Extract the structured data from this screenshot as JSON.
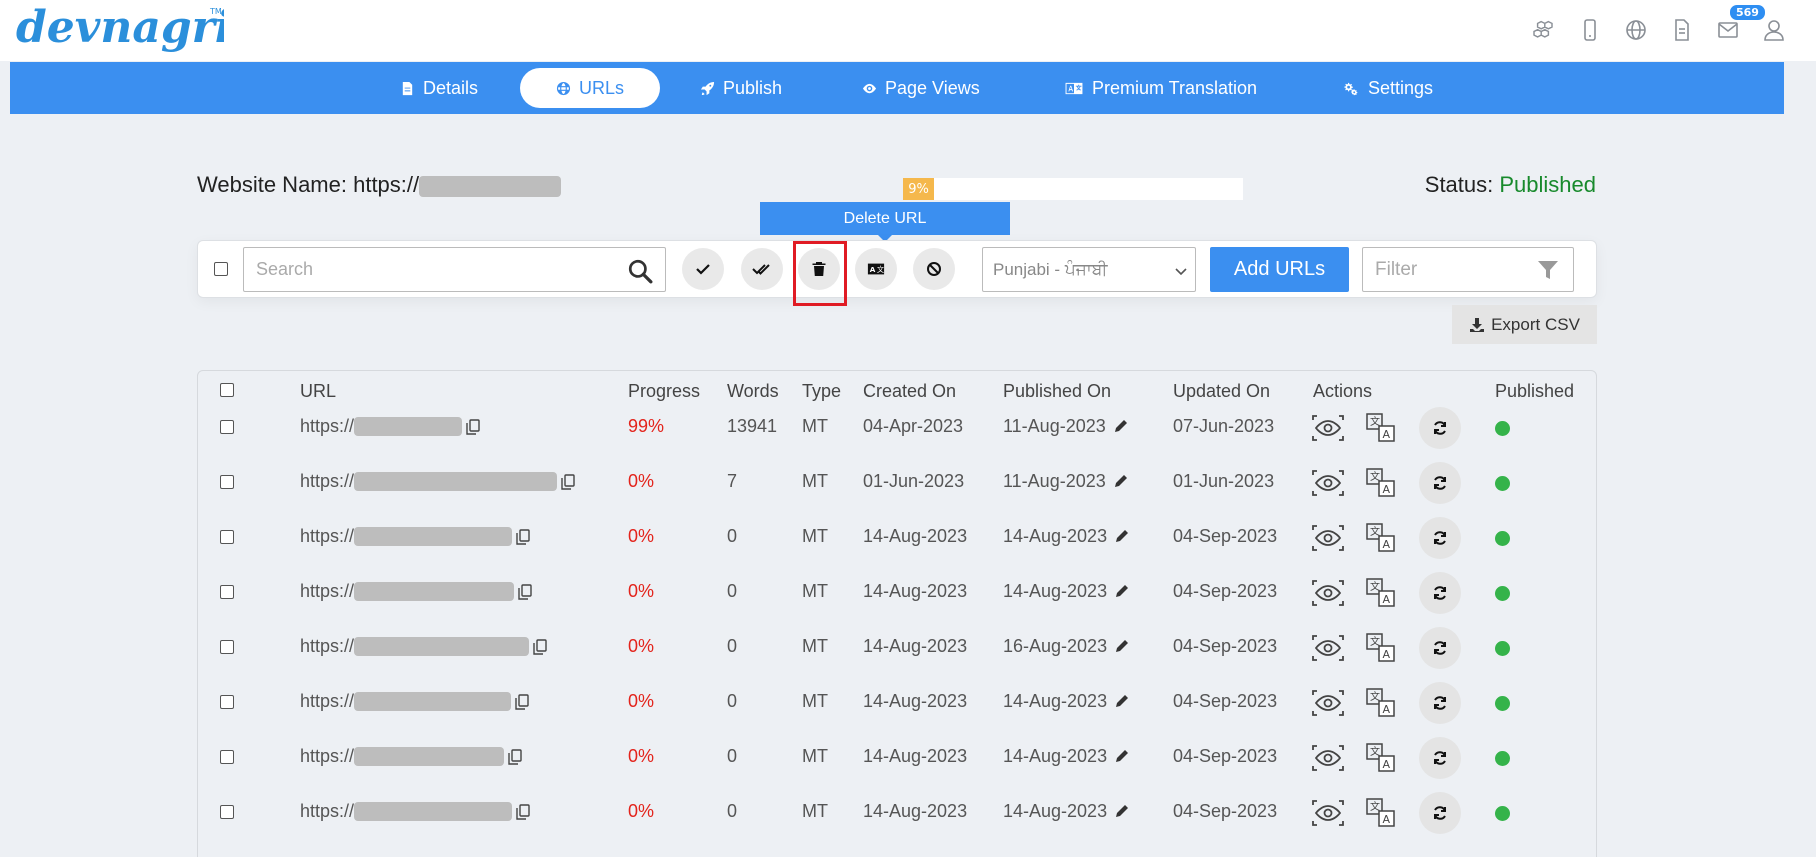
{
  "brand": {
    "logo_text": "devnagri",
    "trademark": "TM"
  },
  "top_icons": [
    {
      "icon": "cubes-icon"
    },
    {
      "icon": "mobile-icon"
    },
    {
      "icon": "globe-icon"
    },
    {
      "icon": "document-icon"
    },
    {
      "icon": "mail-icon",
      "badge": "569"
    },
    {
      "icon": "user-icon"
    }
  ],
  "nav": {
    "items": [
      {
        "label": "Details",
        "icon": "file-icon"
      },
      {
        "label": "URLs",
        "icon": "globe-icon",
        "active": true
      },
      {
        "label": "Publish",
        "icon": "rocket-icon"
      },
      {
        "label": "Page Views",
        "icon": "eye-icon"
      },
      {
        "label": "Premium Translation",
        "icon": "translate-icon"
      },
      {
        "label": "Settings",
        "icon": "gears-icon"
      }
    ]
  },
  "website": {
    "label": "Website Name: https://",
    "progress_label": "9%",
    "progress_value": 0.09
  },
  "status": {
    "label": "Status: ",
    "value": "Published",
    "value_color": "#188a2c"
  },
  "tooltip": {
    "text": "Delete URL"
  },
  "toolbar": {
    "search_placeholder": "Search",
    "language_selected": "Punjabi - ਪੰਜਾਬੀ",
    "add_label": "Add URLs",
    "filter_placeholder": "Filter"
  },
  "export": {
    "label": "Export CSV"
  },
  "table": {
    "headers": {
      "url": "URL",
      "progress": "Progress",
      "words": "Words",
      "type": "Type",
      "created": "Created On",
      "published_on": "Published On",
      "updated": "Updated On",
      "actions": "Actions",
      "published": "Published"
    },
    "rows": [
      {
        "url": "https://",
        "progress": "99%",
        "words": "13941",
        "type": "MT",
        "created": "04-Apr-2023",
        "published_on": "11-Aug-2023",
        "updated": "07-Jun-2023"
      },
      {
        "url": "https://",
        "progress": "0%",
        "words": "7",
        "type": "MT",
        "created": "01-Jun-2023",
        "published_on": "11-Aug-2023",
        "updated": "01-Jun-2023"
      },
      {
        "url": "https://",
        "progress": "0%",
        "words": "0",
        "type": "MT",
        "created": "14-Aug-2023",
        "published_on": "14-Aug-2023",
        "updated": "04-Sep-2023"
      },
      {
        "url": "https://",
        "progress": "0%",
        "words": "0",
        "type": "MT",
        "created": "14-Aug-2023",
        "published_on": "14-Aug-2023",
        "updated": "04-Sep-2023"
      },
      {
        "url": "https://",
        "progress": "0%",
        "words": "0",
        "type": "MT",
        "created": "14-Aug-2023",
        "published_on": "16-Aug-2023",
        "updated": "04-Sep-2023"
      },
      {
        "url": "https://",
        "progress": "0%",
        "words": "0",
        "type": "MT",
        "created": "14-Aug-2023",
        "published_on": "14-Aug-2023",
        "updated": "04-Sep-2023"
      },
      {
        "url": "https://",
        "progress": "0%",
        "words": "0",
        "type": "MT",
        "created": "14-Aug-2023",
        "published_on": "14-Aug-2023",
        "updated": "04-Sep-2023"
      },
      {
        "url": "https://",
        "progress": "0%",
        "words": "0",
        "type": "MT",
        "created": "14-Aug-2023",
        "published_on": "14-Aug-2023",
        "updated": "04-Sep-2023"
      }
    ]
  }
}
